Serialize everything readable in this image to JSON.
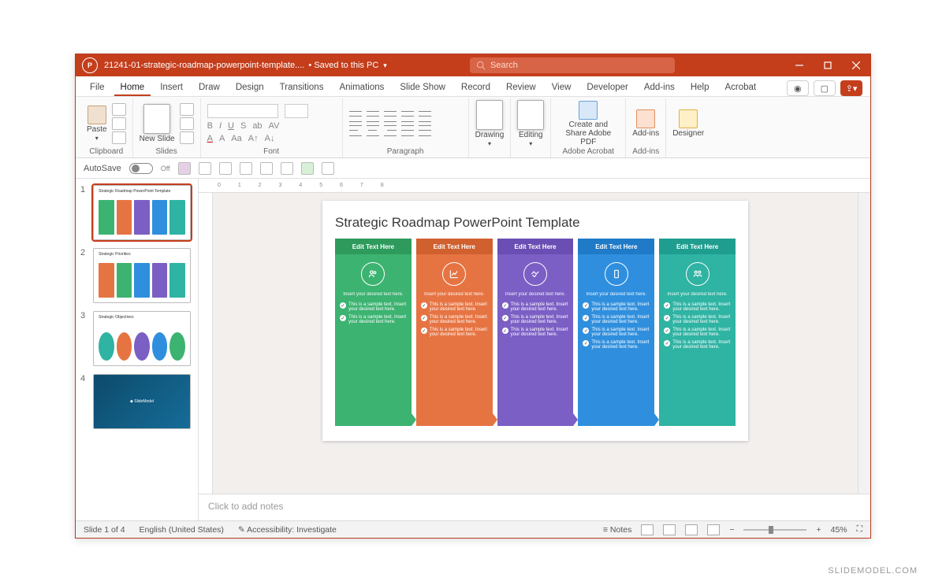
{
  "titlebar": {
    "filename": "21241-01-strategic-roadmap-powerpoint-template....",
    "saved": "Saved to this PC",
    "search_placeholder": "Search"
  },
  "tabs": [
    "File",
    "Home",
    "Insert",
    "Draw",
    "Design",
    "Transitions",
    "Animations",
    "Slide Show",
    "Record",
    "Review",
    "View",
    "Developer",
    "Add-ins",
    "Help",
    "Acrobat"
  ],
  "active_tab": "Home",
  "ribbon": {
    "clipboard": {
      "label": "Clipboard",
      "paste": "Paste"
    },
    "slides": {
      "label": "Slides",
      "new": "New Slide"
    },
    "font": {
      "label": "Font"
    },
    "paragraph": {
      "label": "Paragraph"
    },
    "drawing": {
      "label": "Drawing"
    },
    "editing": {
      "label": "Editing"
    },
    "adobe": {
      "label": "Adobe Acrobat",
      "btn": "Create and Share Adobe PDF"
    },
    "addins": {
      "label": "Add-ins",
      "btn": "Add-ins"
    },
    "designer": {
      "label": "Designer"
    }
  },
  "qat": {
    "autosave": "AutoSave",
    "off": "Off"
  },
  "thumbs": [
    {
      "num": "1",
      "title": "Strategic Roadmap PowerPoint Template"
    },
    {
      "num": "2",
      "title": "Strategic Priorities"
    },
    {
      "num": "3",
      "title": "Strategic Objectives"
    },
    {
      "num": "4",
      "title": "SlideModel"
    }
  ],
  "slide": {
    "title": "Strategic Roadmap PowerPoint Template",
    "col_header": "Edit Text Here",
    "desc": "Insert your desired text here.",
    "bullet": "This is a sample text. Insert your desired text here."
  },
  "notes_placeholder": "Click to add notes",
  "status": {
    "slide": "Slide 1 of 4",
    "lang": "English (United States)",
    "access": "Accessibility: Investigate",
    "notes": "Notes",
    "zoom": "45%"
  },
  "attribution": "SLIDEMODEL.COM"
}
